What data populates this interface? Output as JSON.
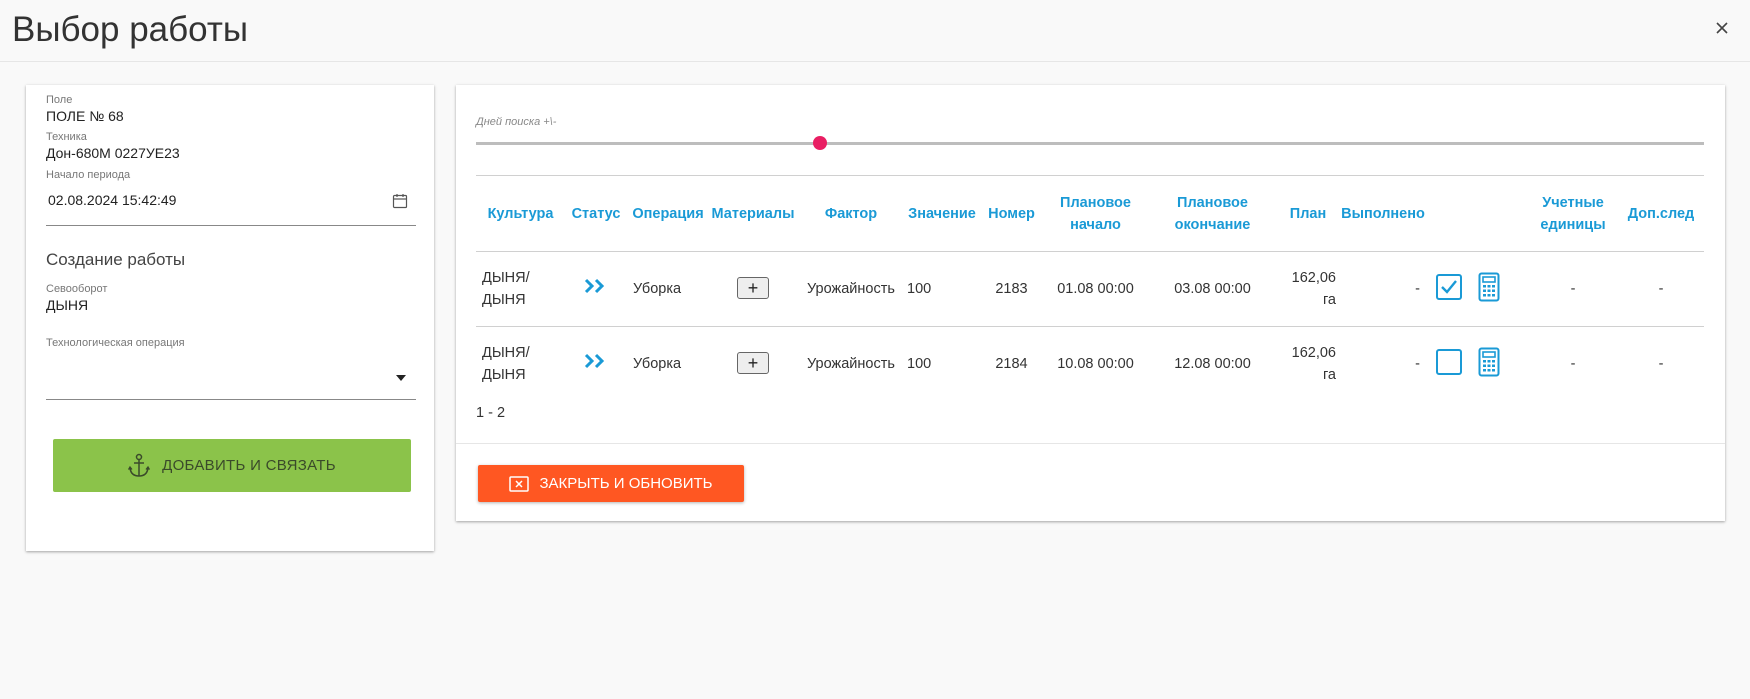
{
  "dialog": {
    "title": "Выбор работы"
  },
  "left_panel": {
    "field": {
      "label": "Поле",
      "value": "ПОЛЕ № 68"
    },
    "machine": {
      "label": "Техника",
      "value": "Дон-680М 0227УЕ23"
    },
    "period_start": {
      "label": "Начало периода",
      "value": "02.08.2024 15:42:49"
    },
    "section_title": "Создание работы",
    "crop_rotation": {
      "label": "Севооборот",
      "value": "ДЫНЯ"
    },
    "tech_operation": {
      "label": "Технологическая операция",
      "value": ""
    },
    "add_button": "ДОБАВИТЬ И СВЯЗАТЬ"
  },
  "right_panel": {
    "slider": {
      "label": "Дней поиска +\\-",
      "value_fraction": 0.28
    },
    "table": {
      "headers": [
        "Культура",
        "Статус",
        "Операция",
        "Материалы",
        "Фактор",
        "Значение",
        "Номер",
        "Плановое начало",
        "Плановое окончание",
        "План",
        "Выполнено",
        "",
        "Учетные единицы",
        "Доп.след"
      ],
      "rows": [
        {
          "culture": "ДЫНЯ/ ДЫНЯ",
          "operation": "Уборка",
          "materials_button": "+",
          "factor": "Урожайность",
          "value": "100",
          "number": "2183",
          "plan_start": "01.08 00:00",
          "plan_end": "03.08 00:00",
          "plan": "162,06 га",
          "done": "-",
          "checked": true,
          "units": "-",
          "extra": "-"
        },
        {
          "culture": "ДЫНЯ/ ДЫНЯ",
          "operation": "Уборка",
          "materials_button": "+",
          "factor": "Урожайность",
          "value": "100",
          "number": "2184",
          "plan_start": "10.08 00:00",
          "plan_end": "12.08 00:00",
          "plan": "162,06 га",
          "done": "-",
          "checked": false,
          "units": "-",
          "extra": "-"
        }
      ]
    },
    "pager": "1 - 2",
    "close_button": "ЗАКРЫТЬ И ОБНОВИТЬ"
  },
  "colors": {
    "accent_blue": "#1a9ad6",
    "add_green": "#8bc34a",
    "close_orange": "#ff5722",
    "slider_pink": "#e91e63"
  }
}
